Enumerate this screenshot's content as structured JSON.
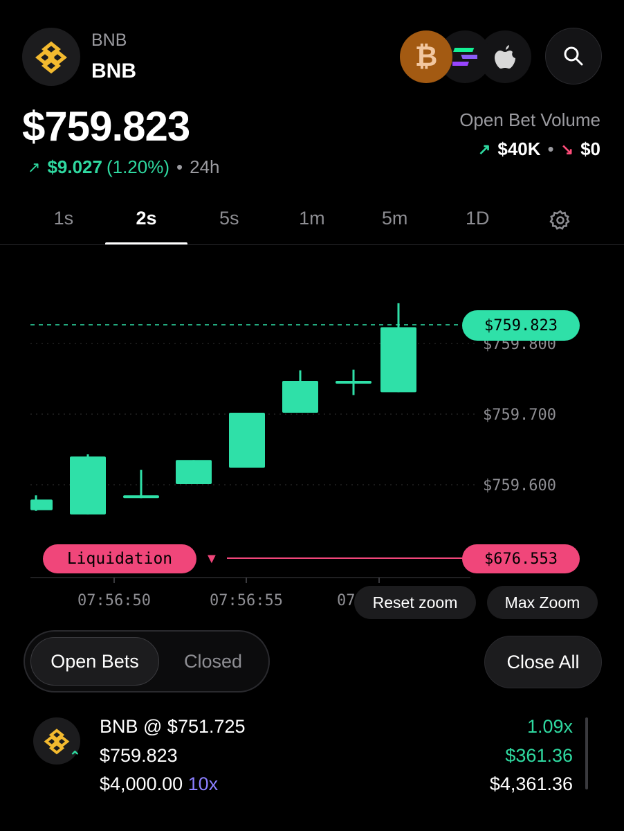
{
  "header": {
    "symbol_small": "BNB",
    "symbol_big": "BNB",
    "price": "$759.823",
    "change_value": "$9.027",
    "change_pct": "(1.20%)",
    "change_sep": "•",
    "change_period": "24h",
    "open_bet_volume_label": "Open Bet Volume",
    "volume_up": "$40K",
    "volume_sep": "•",
    "volume_down": "$0"
  },
  "quick_coins": [
    "bitcoin-icon",
    "solana-icon",
    "apple-icon"
  ],
  "tabs": [
    {
      "label": "1s",
      "active": false
    },
    {
      "label": "2s",
      "active": true
    },
    {
      "label": "5s",
      "active": false
    },
    {
      "label": "1m",
      "active": false
    },
    {
      "label": "5m",
      "active": false
    },
    {
      "label": "1D",
      "active": false
    }
  ],
  "chart": {
    "current_price_tag": "$759.823",
    "liquidation_label": "Liquidation",
    "liquidation_price_tag": "$676.553",
    "y_tick_labels": [
      "$759.800",
      "$759.700",
      "$759.600"
    ],
    "x_tick_labels": [
      "07:56:50",
      "07:56:55",
      "07"
    ],
    "reset_zoom_label": "Reset zoom",
    "max_zoom_label": "Max Zoom"
  },
  "chart_data": {
    "type": "candlestick",
    "y_ticks": [
      759.8,
      759.7,
      759.6
    ],
    "current_price": 759.823,
    "liquidation_price": 676.553,
    "candles": [
      {
        "open": 759.564,
        "close": 759.579,
        "high": 759.585,
        "low": 759.563
      },
      {
        "open": 759.558,
        "close": 759.64,
        "high": 759.643,
        "low": 759.558
      },
      {
        "open": 759.585,
        "close": 759.585,
        "high": 759.621,
        "low": 759.581
      },
      {
        "open": 759.601,
        "close": 759.635,
        "high": 759.635,
        "low": 759.601
      },
      {
        "open": 759.624,
        "close": 759.702,
        "high": 759.702,
        "low": 759.624
      },
      {
        "open": 759.702,
        "close": 759.747,
        "high": 759.762,
        "low": 759.702
      },
      {
        "open": 759.747,
        "close": 759.747,
        "high": 759.763,
        "low": 759.727
      },
      {
        "open": 759.731,
        "close": 759.823,
        "high": 759.857,
        "low": 759.731
      }
    ]
  },
  "bets": {
    "open_label": "Open Bets",
    "closed_label": "Closed",
    "close_all_label": "Close All",
    "rows": [
      {
        "title": "BNB @ $751.725",
        "current_price": "$759.823",
        "amount": "$4,000.00",
        "leverage": "10x",
        "multiplier": "1.09x",
        "pnl": "$361.36",
        "value": "$4,361.36"
      }
    ]
  }
}
